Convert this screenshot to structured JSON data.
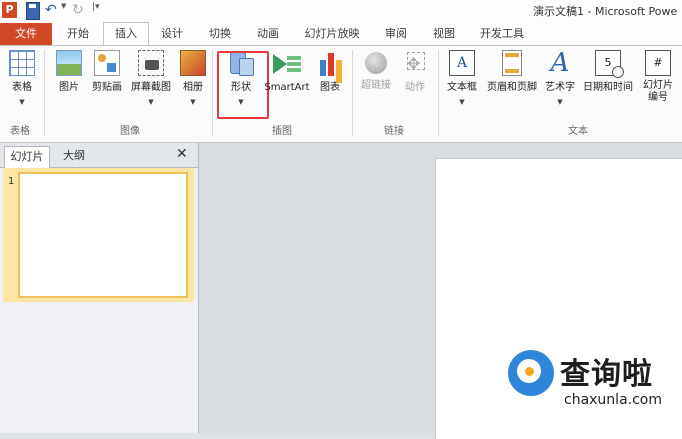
{
  "app": {
    "icon_letter": "P",
    "title": "演示文稿1 - Microsoft Powe"
  },
  "tabs": [
    {
      "label": "文件"
    },
    {
      "label": "开始"
    },
    {
      "label": "插入"
    },
    {
      "label": "设计"
    },
    {
      "label": "切换"
    },
    {
      "label": "动画"
    },
    {
      "label": "幻灯片放映"
    },
    {
      "label": "审阅"
    },
    {
      "label": "视图"
    },
    {
      "label": "开发工具"
    }
  ],
  "ribbon": {
    "groups": [
      "表格",
      "图像",
      "插图",
      "链接",
      "文本"
    ],
    "buttons": {
      "table": "表格",
      "picture": "图片",
      "clipart": "剪贴画",
      "screenshot": "屏幕截图",
      "album": "相册",
      "shape": "形状",
      "smartart": "SmartArt",
      "chart": "图表",
      "hyperlink": "超链接",
      "action": "动作",
      "textbox": "文本框",
      "header_footer": "页眉和页脚",
      "wordart": "艺术字",
      "datetime": "日期和时间",
      "slide_number_1": "幻灯片",
      "slide_number_2": "编号"
    },
    "icon_glyphs": {
      "textbox": "A",
      "wordart": "A",
      "date": "5",
      "slide_number": "#"
    },
    "highlight_color": "#e23b3b"
  },
  "left_pane": {
    "tab_slides": "幻灯片",
    "tab_outline": "大纲",
    "close_glyph": "✕",
    "slide_number": "1"
  },
  "watermark": {
    "text": "查询啦",
    "sub": "chaxunla.com"
  },
  "colors": {
    "file_tab": "#d24726",
    "accent_blue": "#2f86d8",
    "accent_orange": "#f5a623"
  }
}
